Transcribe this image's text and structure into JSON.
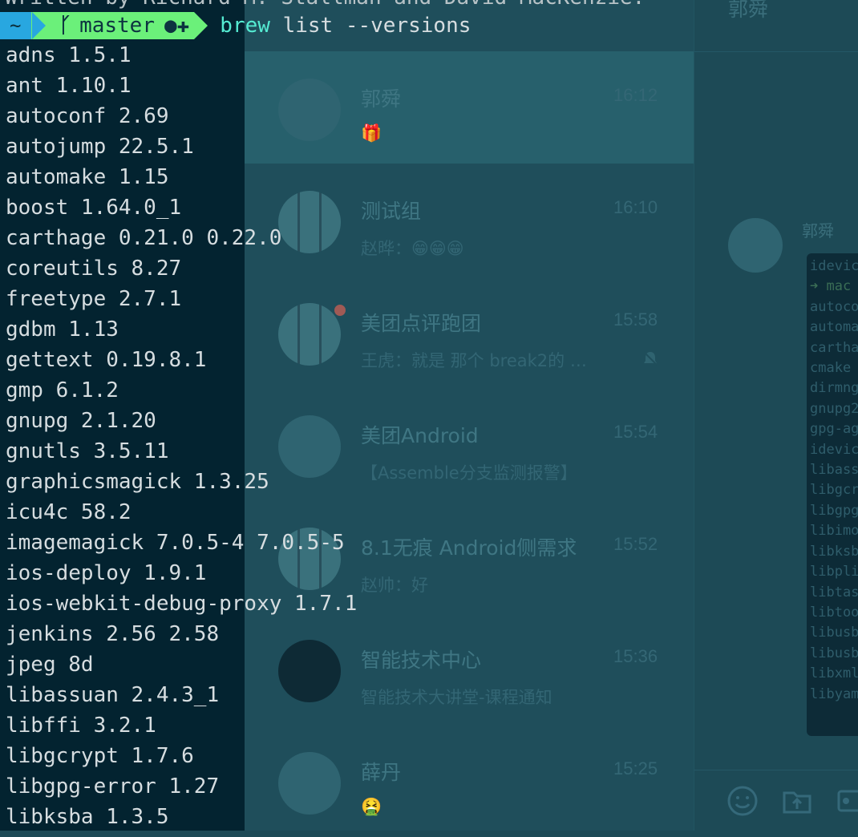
{
  "terminal": {
    "previous_line": "Written by Richard M. Stallman and David MacKenzie.",
    "prompt": {
      "cwd": "~",
      "branch_icon": "ᚴ",
      "branch": "master",
      "status": "●✚"
    },
    "command": {
      "name": "brew",
      "args": "list --versions"
    },
    "packages": [
      "adns 1.5.1",
      "ant 1.10.1",
      "autoconf 2.69",
      "autojump 22.5.1",
      "automake 1.15",
      "boost 1.64.0_1",
      "carthage 0.21.0 0.22.0",
      "coreutils 8.27",
      "freetype 2.7.1",
      "gdbm 1.13",
      "gettext 0.19.8.1",
      "gmp 6.1.2",
      "gnupg 2.1.20",
      "gnutls 3.5.11",
      "graphicsmagick 1.3.25",
      "icu4c 58.2",
      "imagemagick 7.0.5-4 7.0.5-5",
      "ios-deploy 1.9.1",
      "ios-webkit-debug-proxy 1.7.1",
      "jenkins 2.56 2.58",
      "jpeg 8d",
      "libassuan 2.4.3_1",
      "libffi 3.2.1",
      "libgcrypt 1.7.6",
      "libgpg-error 1.27",
      "libksba 1.3.5"
    ]
  },
  "chat": {
    "nav_icons": [
      "chat-bubble-icon",
      "contacts-icon",
      "folder-icon",
      "task-check-icon",
      "apps-grid-icon"
    ],
    "conversations": [
      {
        "name": "郭舜",
        "time": "16:12",
        "preview": "🎁",
        "active": true
      },
      {
        "name": "测试组",
        "time": "16:10",
        "preview": "赵晔：😁😁😁",
        "active": false
      },
      {
        "name": "美团点评跑团",
        "time": "15:58",
        "preview": "王虎：就是 那个 break2的 …",
        "unread": true,
        "muted": true
      },
      {
        "name": "美团Android",
        "time": "15:54",
        "preview": "【Assemble分支监测报警】"
      },
      {
        "name": "8.1无痕 Android侧需求",
        "time": "15:52",
        "preview": "赵帅：好"
      },
      {
        "name": "智能技术中心",
        "time": "15:36",
        "preview": "智能技术大讲堂-课程通知"
      },
      {
        "name": "薛丹",
        "time": "15:25",
        "preview": "🤮"
      }
    ],
    "detail": {
      "title": "郭舜",
      "sender": "郭舜",
      "bubble_lines": [
        "idevic",
        "➜ mac",
        "autoco",
        "automa",
        "cartha",
        "cmake",
        "dirmng",
        "gnupg2",
        "gpg-ag",
        "idevic",
        "libass",
        "libgcr",
        "libgpg",
        "libimo",
        "libksb",
        "libpli",
        "libtas",
        "libtoo",
        "libusb",
        "libusb",
        "libxml",
        "libyam"
      ]
    }
  }
}
